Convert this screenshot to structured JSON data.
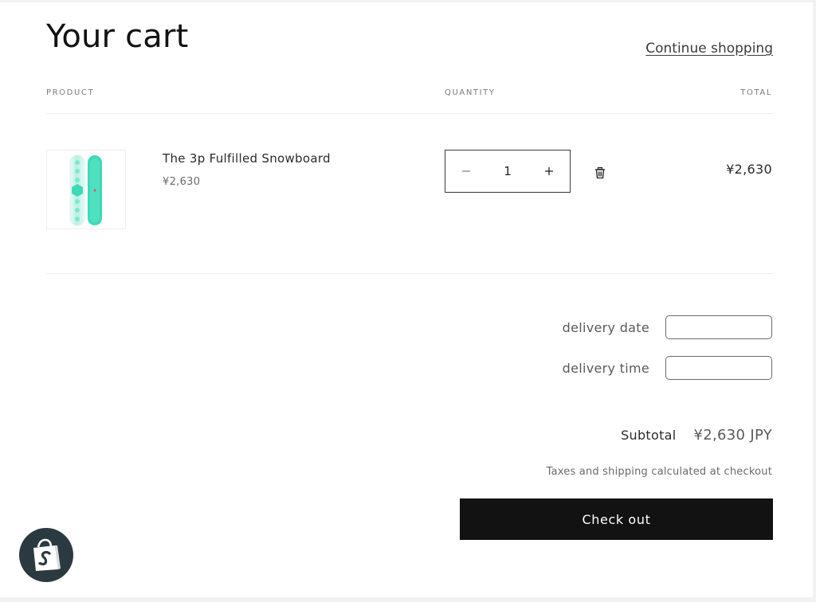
{
  "header": {
    "title": "Your cart",
    "continue_label": "Continue shopping"
  },
  "columns": {
    "product": "PRODUCT",
    "quantity": "QUANTITY",
    "total": "TOTAL"
  },
  "items": [
    {
      "name": "The 3p Fulfilled Snowboard",
      "price": "¥2,630",
      "quantity": "1",
      "line_total": "¥2,630",
      "image": "teal-snowboard-image"
    }
  ],
  "attributes": {
    "delivery_date_label": "delivery date",
    "delivery_date_value": "",
    "delivery_time_label": "delivery time",
    "delivery_time_value": ""
  },
  "summary": {
    "subtotal_label": "Subtotal",
    "subtotal_value": "¥2,630 JPY",
    "taxes_note": "Taxes and shipping calculated at checkout",
    "checkout_label": "Check out"
  },
  "icons": {
    "minus": "minus-icon",
    "plus": "plus-icon",
    "trash": "trash-icon",
    "shopify": "shopify-bag-icon"
  },
  "colors": {
    "accent": "#121212",
    "snowboard": "#3fd9b8",
    "shopify_badge": "#2b3a40"
  }
}
